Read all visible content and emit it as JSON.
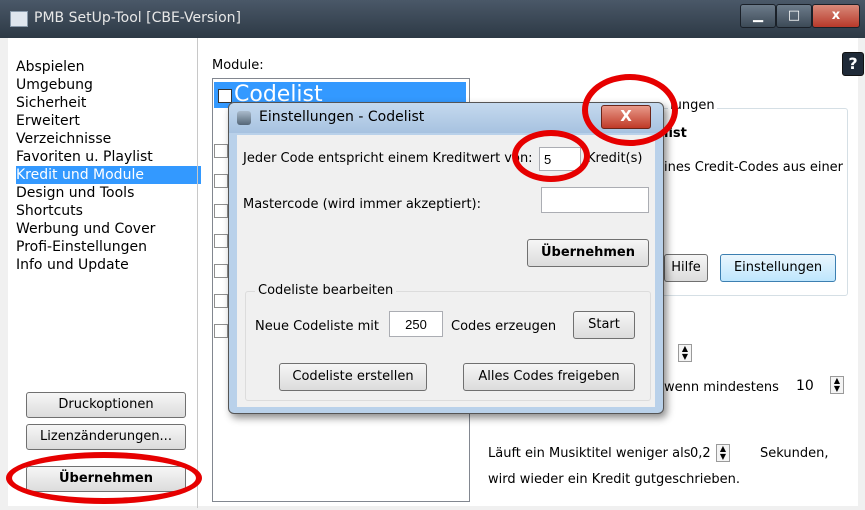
{
  "window": {
    "title": "PMB SetUp-Tool [CBE-Version]",
    "min_label": "▁",
    "max_label": "□",
    "close_label": "x",
    "help_label": "?"
  },
  "sidebar": {
    "items": [
      {
        "label": "Abspielen"
      },
      {
        "label": "Umgebung"
      },
      {
        "label": "Sicherheit"
      },
      {
        "label": "Erweitert"
      },
      {
        "label": "Verzeichnisse"
      },
      {
        "label": "Favoriten u. Playlist"
      },
      {
        "label": "Kredit und Module",
        "selected": true
      },
      {
        "label": "Design und Tools"
      },
      {
        "label": "Shortcuts"
      },
      {
        "label": "Werbung und Cover"
      },
      {
        "label": "Profi-Einstellungen"
      },
      {
        "label": "Info und Update"
      }
    ],
    "print_button": "Druckoptionen",
    "license_button": "Lizenzänderungen...",
    "apply_button": "Übernehmen"
  },
  "modules": {
    "header": "Module:",
    "selected_module": "Codelist"
  },
  "right_panel": {
    "group_title_fragment": "lungen",
    "desc_bold": "list",
    "desc_text": "ines Credit-Codes aus einer",
    "help_button": "Hilfe",
    "settings_button": "Einstellungen",
    "min_text": "wenn mindestens",
    "min_value": "10",
    "short_track_prefix": "Läuft ein Musiktitel weniger als",
    "short_track_value": "0,2",
    "short_track_unit": "Sekunden,",
    "credit_back_text": "wird wieder ein Kredit gutgeschrieben."
  },
  "dialog": {
    "title": "Einstellungen - Codelist",
    "close_label": "X",
    "code_value_label": "Jeder Code entspricht einem Kreditwert von:",
    "code_value": "5",
    "code_value_unit": "Kredit(s)",
    "mastercode_label": "Mastercode (wird immer akzeptiert):",
    "mastercode_value": "",
    "apply_button": "Übernehmen",
    "group_title": "Codeliste bearbeiten",
    "new_list_label": "Neue Codeliste mit",
    "new_list_count": "250",
    "new_list_suffix": "Codes erzeugen",
    "start_button": "Start",
    "create_list_button": "Codeliste erstellen",
    "release_all_button": "Alles Codes freigeben"
  },
  "colors": {
    "selection": "#3399ff",
    "annotation_red": "#e60000"
  }
}
